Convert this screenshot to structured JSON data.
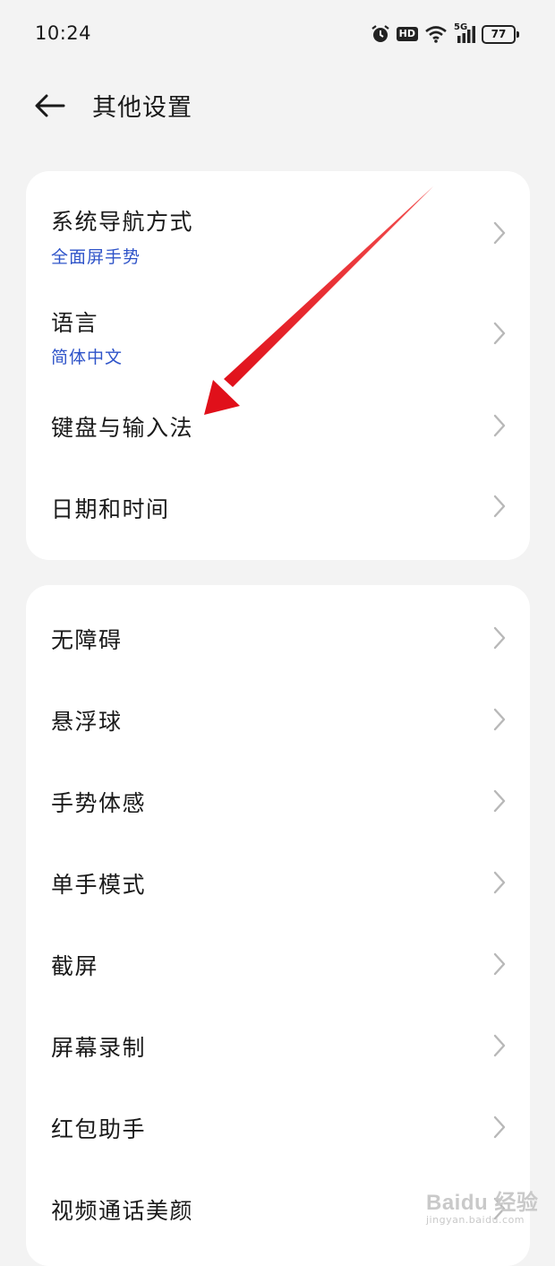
{
  "status_bar": {
    "time": "10:24",
    "hd_label": "HD",
    "network_label": "5G",
    "battery_level": "77",
    "icons": [
      "alarm-icon",
      "hd-icon",
      "wifi-icon",
      "5g-signal-icon",
      "battery-icon"
    ]
  },
  "header": {
    "back_icon": "arrow-left-icon",
    "title": "其他设置"
  },
  "card1": {
    "items": [
      {
        "title": "系统导航方式",
        "subtitle": "全面屏手势"
      },
      {
        "title": "语言",
        "subtitle": "简体中文"
      },
      {
        "title": "键盘与输入法"
      },
      {
        "title": "日期和时间"
      }
    ]
  },
  "card2": {
    "items": [
      {
        "title": "无障碍"
      },
      {
        "title": "悬浮球"
      },
      {
        "title": "手势体感"
      },
      {
        "title": "单手模式"
      },
      {
        "title": "截屏"
      },
      {
        "title": "屏幕录制"
      },
      {
        "title": "红包助手"
      },
      {
        "title": "视频通话美颜"
      }
    ]
  },
  "annotation": {
    "color": "#e0101a",
    "icon": "red-arrow-icon"
  },
  "watermark": {
    "main": "Baidu 经验",
    "sub": "jingyan.baidu.com"
  },
  "colors": {
    "background": "#f3f3f3",
    "card": "#ffffff",
    "accent_subtitle": "#2f54c9",
    "chevron": "#b8b8b8"
  }
}
